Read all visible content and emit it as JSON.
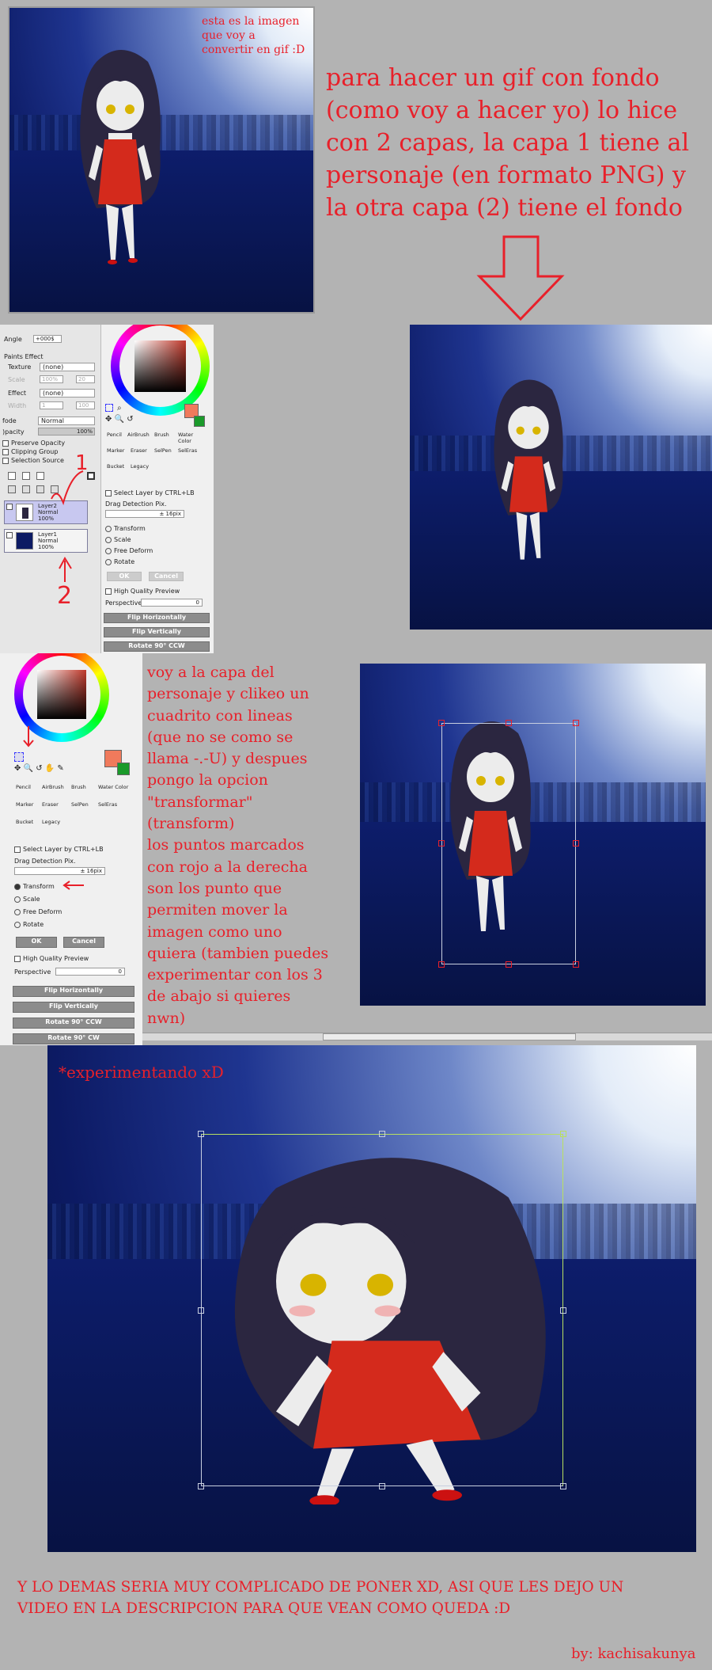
{
  "panel1": {
    "caption_lines": [
      "esta es la imagen",
      "que voy a",
      "convertir en gif :D"
    ],
    "intro_lines": [
      "para hacer un gif con fondo",
      "(como voy a hacer yo) lo hice",
      "con 2 capas, la capa 1 tiene al",
      "personaje (en formato PNG) y",
      "la otra capa (2) tiene el fondo"
    ]
  },
  "sai1": {
    "angle_label": "Angle",
    "angle_value": "+000$",
    "paints_effect": "Paints Effect",
    "texture_label": "Texture",
    "texture_value": "(none)",
    "scale_label": "Scale",
    "scale_value": "100%",
    "scale_num": "20",
    "effect_label": "Effect",
    "effect_value": "(none)",
    "width_label": "Width",
    "width_value": "1",
    "width_num": "100",
    "mode_label": "fode",
    "mode_value": "Normal",
    "opacity_label": ")pacity",
    "opacity_value": "100%",
    "checks": [
      "Preserve Opacity",
      "Clipping Group",
      "Selection Source"
    ],
    "layers": [
      {
        "name": "Layer2",
        "mode": "Normal",
        "opacity": "100%"
      },
      {
        "name": "Layer1",
        "mode": "Normal",
        "opacity": "100%"
      }
    ],
    "tools": [
      "Pencil",
      "AirBrush",
      "Brush",
      "Water Color",
      "Marker",
      "Eraser",
      "SelPen",
      "SelEras",
      "Bucket",
      "Legacy"
    ],
    "select_layer": "Select Layer by CTRL+LB",
    "drag_detection": "Drag Detection Pix.",
    "drag_value": "± 16pix",
    "radios": [
      "Transform",
      "Scale",
      "Free Deform",
      "Rotate"
    ],
    "ok": "OK",
    "cancel": "Cancel",
    "hq_preview": "High Quality Preview",
    "perspective": "Perspective",
    "perspective_value": "0",
    "buttons": [
      "Flip Horizontally",
      "Flip Vertically",
      "Rotate 90° CCW"
    ],
    "annot_1": "1",
    "annot_2": "2"
  },
  "sai2": {
    "tools": [
      "Pencil",
      "AirBrush",
      "Brush",
      "Water Color",
      "Marker",
      "Eraser",
      "SelPen",
      "SelEras",
      "Bucket",
      "Legacy"
    ],
    "select_layer": "Select Layer by CTRL+LB",
    "drag_detection": "Drag Detection Pix.",
    "drag_value": "± 16pix",
    "radios": [
      "Transform",
      "Scale",
      "Free Deform",
      "Rotate"
    ],
    "ok": "OK",
    "cancel": "Cancel",
    "hq_preview": "High Quality Preview",
    "perspective": "Perspective",
    "perspective_value": "0",
    "buttons": [
      "Flip Horizontally",
      "Flip Vertically",
      "Rotate 90° CCW",
      "Rotate 90° CW"
    ]
  },
  "panel3": {
    "explain_lines": [
      "voy a la capa del",
      "personaje y clikeo un",
      "cuadrito con lineas",
      "(que no se como se",
      "llama -.-U) y despues",
      "pongo la opcion",
      "\"transformar\"",
      "(transform)",
      "los puntos marcados",
      "con rojo a la derecha",
      "son los punto que",
      "permiten mover la",
      "imagen como uno",
      "quiera (tambien puedes",
      "experimentar con los 3",
      "de abajo si quieres",
      "nwn)"
    ]
  },
  "panel4": {
    "caption": "*experimentando xD"
  },
  "footer": {
    "line1": "Y LO DEMAS SERIA MUY COMPLICADO DE PONER XD, ASI QUE LES DEJO UN",
    "line2": "VIDEO EN LA DESCRIPCION PARA QUE VEAN COMO QUEDA :D",
    "signature": "by: kachisakunya"
  },
  "colors": {
    "annotation_red": "#e8202a",
    "sky_dark": "#0c1a63",
    "dress_red": "#d42a1c",
    "hair": "#2b2640"
  }
}
